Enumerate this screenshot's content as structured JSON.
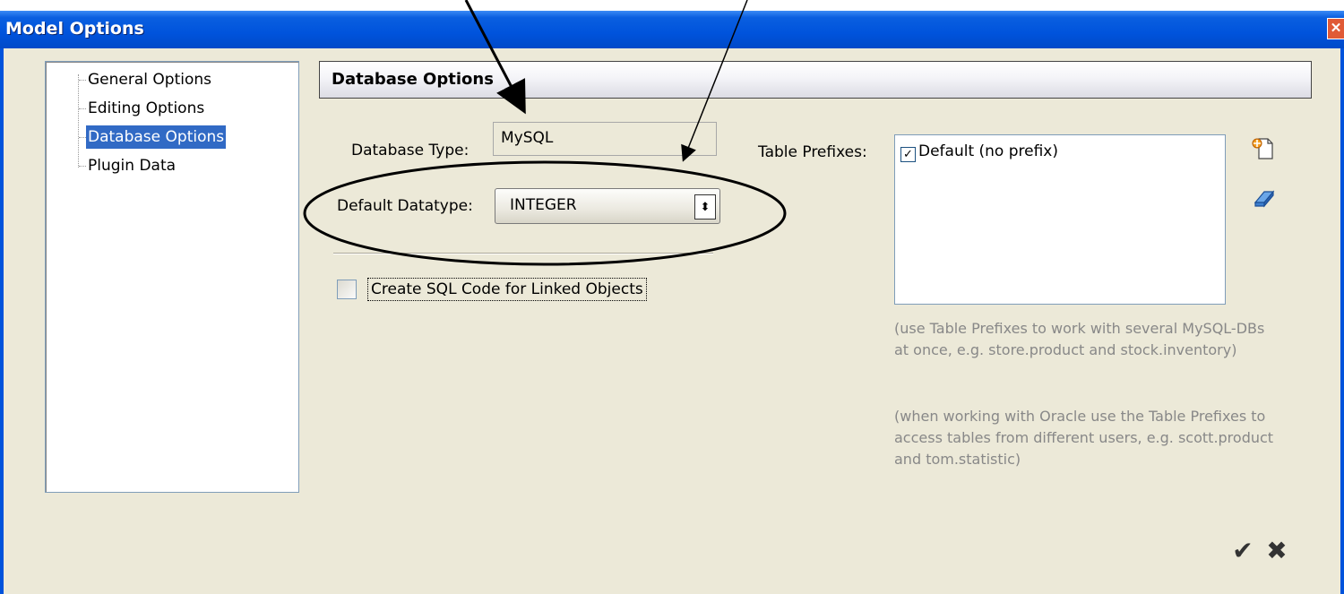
{
  "window": {
    "title": "Model Options",
    "close_glyph": "✕"
  },
  "tree": {
    "items": [
      {
        "label": "General Options"
      },
      {
        "label": "Editing Options"
      },
      {
        "label": "Database Options",
        "selected": true
      },
      {
        "label": "Plugin Data"
      }
    ]
  },
  "section": {
    "title": "Database Options"
  },
  "form": {
    "database_type_label": "Database Type:",
    "database_type_value": "MySQL",
    "default_datatype_label": "Default Datatype:",
    "default_datatype_value": "INTEGER",
    "linked_objects_label": "Create SQL Code for Linked Objects",
    "linked_objects_checked": false
  },
  "prefixes": {
    "label": "Table Prefixes:",
    "items": [
      {
        "label": "Default (no prefix)",
        "checked": true
      }
    ],
    "hint1": "(use Table Prefixes to work with several MySQL-DBs at once, e.g. store.product and stock.inventory)",
    "hint2": "(when working with Oracle use the Table Prefixes to access tables from different users, e.g. scott.product and tom.statistic)"
  },
  "actions": {
    "ok_glyph": "✔",
    "cancel_glyph": "✖"
  },
  "icons": {
    "add_prefix": "new-page-icon",
    "erase_prefix": "eraser-icon"
  },
  "colors": {
    "titlebar": "#0053dc",
    "selection": "#316ac5",
    "annotation": "#000000"
  }
}
